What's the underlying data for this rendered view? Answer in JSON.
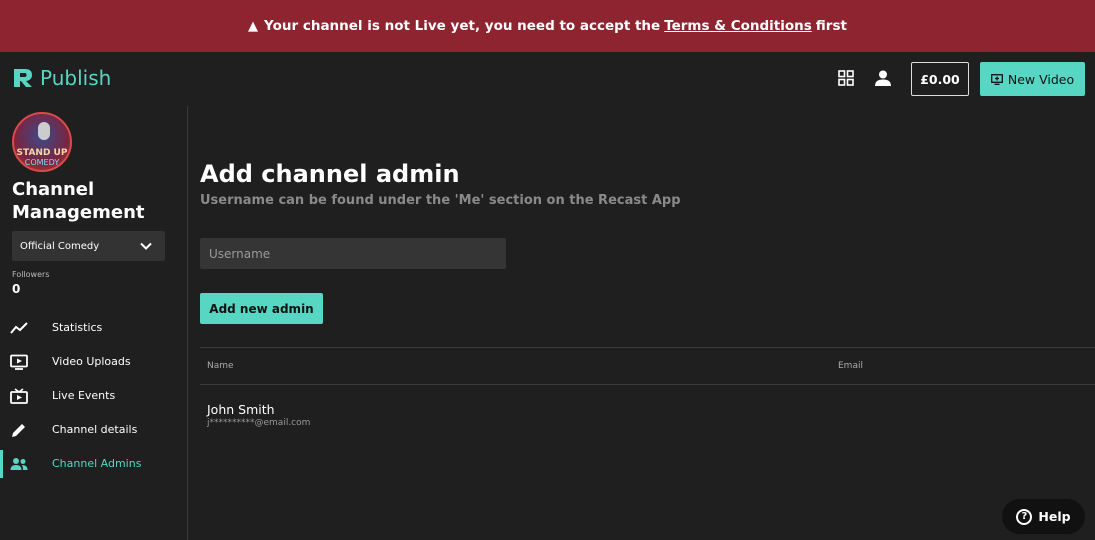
{
  "banner": {
    "text_before": "Your channel is not Live yet, you need to accept the",
    "link": "Terms & Conditions",
    "text_after": "first",
    "icon": "warning-icon"
  },
  "topbar": {
    "app_name": "Publish",
    "balance": "£0.00",
    "new_video_label": "New Video",
    "icons": [
      "grid-icon",
      "user-icon",
      "screen-plus-icon"
    ]
  },
  "sidebar": {
    "avatar_text_line1": "STAND UP",
    "avatar_text_line2": "COMEDY",
    "title": "Channel Management",
    "selected_channel": "Official Comedy",
    "followers_label": "Followers",
    "followers_value": "0",
    "items": [
      {
        "label": "Statistics",
        "icon": "trending-line-icon"
      },
      {
        "label": "Video Uploads",
        "icon": "video-screen-icon"
      },
      {
        "label": "Live Events",
        "icon": "live-tv-icon"
      },
      {
        "label": "Channel details",
        "icon": "pencil-icon"
      },
      {
        "label": "Channel Admins",
        "icon": "users-icon",
        "active": true
      }
    ]
  },
  "main": {
    "title": "Add channel admin",
    "subtitle": "Username can be found under the 'Me' section on the Recast App",
    "username_placeholder": "Username",
    "add_button": "Add new admin",
    "columns": [
      "Name",
      "Email"
    ],
    "rows": [
      {
        "name": "John Smith",
        "email": "j**********@email.com"
      }
    ]
  },
  "help": {
    "label": "Help"
  },
  "colors": {
    "accent": "#57d6c3",
    "banner": "#8e2430",
    "background": "#1f1f1f"
  }
}
